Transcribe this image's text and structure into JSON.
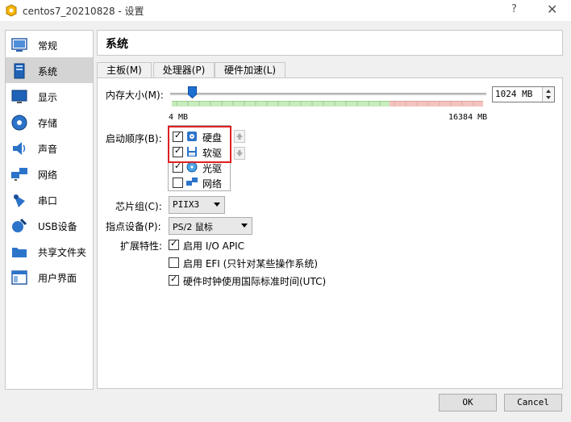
{
  "window": {
    "title": "centos7_20210828 - 设置",
    "help": "?",
    "close": "✕"
  },
  "sidebar": {
    "items": [
      {
        "label": "常规",
        "icon": "general-icon"
      },
      {
        "label": "系统",
        "icon": "system-icon",
        "selected": true
      },
      {
        "label": "显示",
        "icon": "display-icon"
      },
      {
        "label": "存储",
        "icon": "storage-icon"
      },
      {
        "label": "声音",
        "icon": "audio-icon"
      },
      {
        "label": "网络",
        "icon": "network-icon"
      },
      {
        "label": "串口",
        "icon": "serial-port-icon"
      },
      {
        "label": "USB设备",
        "icon": "usb-icon"
      },
      {
        "label": "共享文件夹",
        "icon": "shared-folder-icon"
      },
      {
        "label": "用户界面",
        "icon": "user-interface-icon"
      }
    ]
  },
  "header": {
    "title": "系统"
  },
  "tabs": [
    {
      "label": "主板(M)",
      "active": true
    },
    {
      "label": "处理器(P)"
    },
    {
      "label": "硬件加速(L)"
    }
  ],
  "motherboard": {
    "memory_label": "内存大小(M):",
    "memory_value": "1024 MB",
    "memory_fraction": 0.0625,
    "scale_min": "4 MB",
    "scale_max": "16384 MB",
    "boot_order_label": "启动顺序(B):",
    "boot_items": [
      {
        "label": "硬盘",
        "checked": true,
        "icon": "hard-disk-icon"
      },
      {
        "label": "软驱",
        "checked": true,
        "icon": "floppy-icon"
      },
      {
        "label": "光驱",
        "checked": true,
        "icon": "optical-drive-icon"
      },
      {
        "label": "网络",
        "checked": false,
        "icon": "network-boot-icon"
      }
    ],
    "chipset_label": "芯片组(C):",
    "chipset_value": "PIIX3",
    "pointing_label": "指点设备(P):",
    "pointing_value": "PS/2 鼠标",
    "features_label": "扩展特性:",
    "features": [
      {
        "label": "启用 I/O APIC",
        "checked": true
      },
      {
        "label": "启用 EFI (只针对某些操作系统)",
        "checked": false
      },
      {
        "label": "硬件时钟使用国际标准时间(UTC)",
        "checked": true
      }
    ]
  },
  "buttons": {
    "ok": "OK",
    "cancel": "Cancel"
  },
  "colors": {
    "scale_green": "#c7ecbd",
    "scale_red": "#f3c5c0",
    "highlight": "#e02020",
    "thumb": "#1c6fd1"
  }
}
